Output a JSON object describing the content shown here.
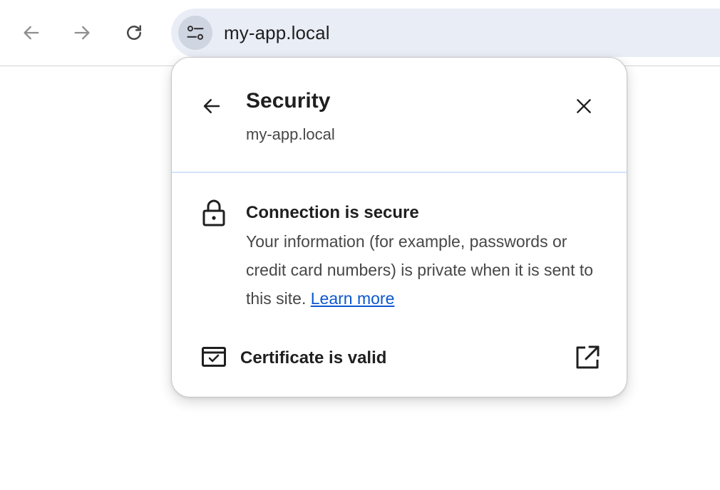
{
  "toolbar": {
    "back_icon": "arrow-left-icon",
    "forward_icon": "arrow-right-icon",
    "reload_icon": "reload-icon",
    "site_info_icon": "tune-icon",
    "url": "my-app.local",
    "colors": {
      "omnibox_bg": "#e9edf6",
      "site_info_bg": "#cfd5e1",
      "disabled_icon": "#8e8e8e"
    }
  },
  "popup": {
    "title": "Security",
    "subtitle": "my-app.local",
    "back_icon": "arrow-left-icon",
    "close_icon": "close-icon",
    "connection": {
      "icon": "lock-icon",
      "title": "Connection is secure",
      "description": "Your information (for example, passwords or credit card numbers) is private when it is sent to this site.",
      "learn_more": "Learn more"
    },
    "certificate": {
      "icon": "certificate-icon",
      "label": "Certificate is valid",
      "open_icon": "external-link-icon"
    },
    "colors": {
      "divider": "#d3e3fd",
      "link": "#0b57d0"
    }
  }
}
